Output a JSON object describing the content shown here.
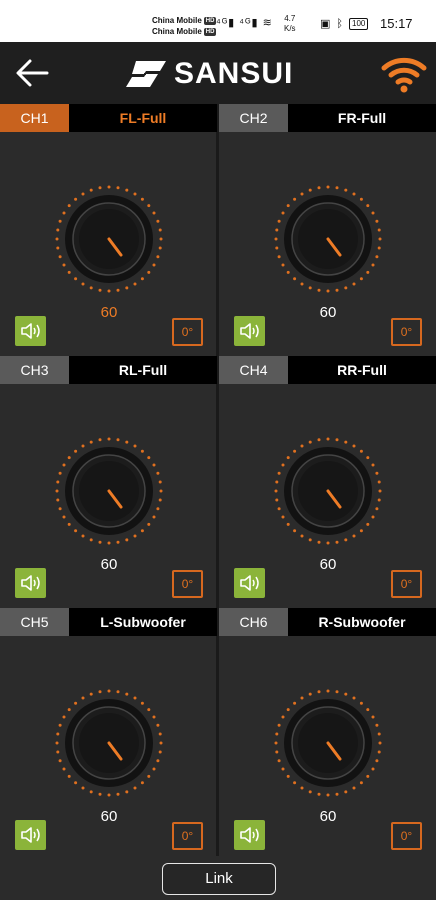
{
  "status_bar": {
    "carrier1": "China Mobile",
    "carrier2": "China Mobile",
    "hd1": "HD",
    "hd2": "HD",
    "signal": "⁴ᴳ▮ ⁴ᴳ▮ ≋",
    "speed_value": "4.7",
    "speed_unit": "K/s",
    "battery": "100",
    "time": "15:17"
  },
  "header": {
    "logo_text": "SANSUI",
    "accent_color": "#ee7c26"
  },
  "channels": [
    {
      "tab": "CH1",
      "name": "FL-Full",
      "value": "60",
      "phase": "0°",
      "active": true
    },
    {
      "tab": "CH2",
      "name": "FR-Full",
      "value": "60",
      "phase": "0°",
      "active": false
    },
    {
      "tab": "CH3",
      "name": "RL-Full",
      "value": "60",
      "phase": "0°",
      "active": false
    },
    {
      "tab": "CH4",
      "name": "RR-Full",
      "value": "60",
      "phase": "0°",
      "active": false
    },
    {
      "tab": "CH5",
      "name": "L-Subwoofer",
      "value": "60",
      "phase": "0°",
      "active": false
    },
    {
      "tab": "CH6",
      "name": "R-Subwoofer",
      "value": "60",
      "phase": "0°",
      "active": false
    }
  ],
  "footer": {
    "link_label": "Link"
  }
}
